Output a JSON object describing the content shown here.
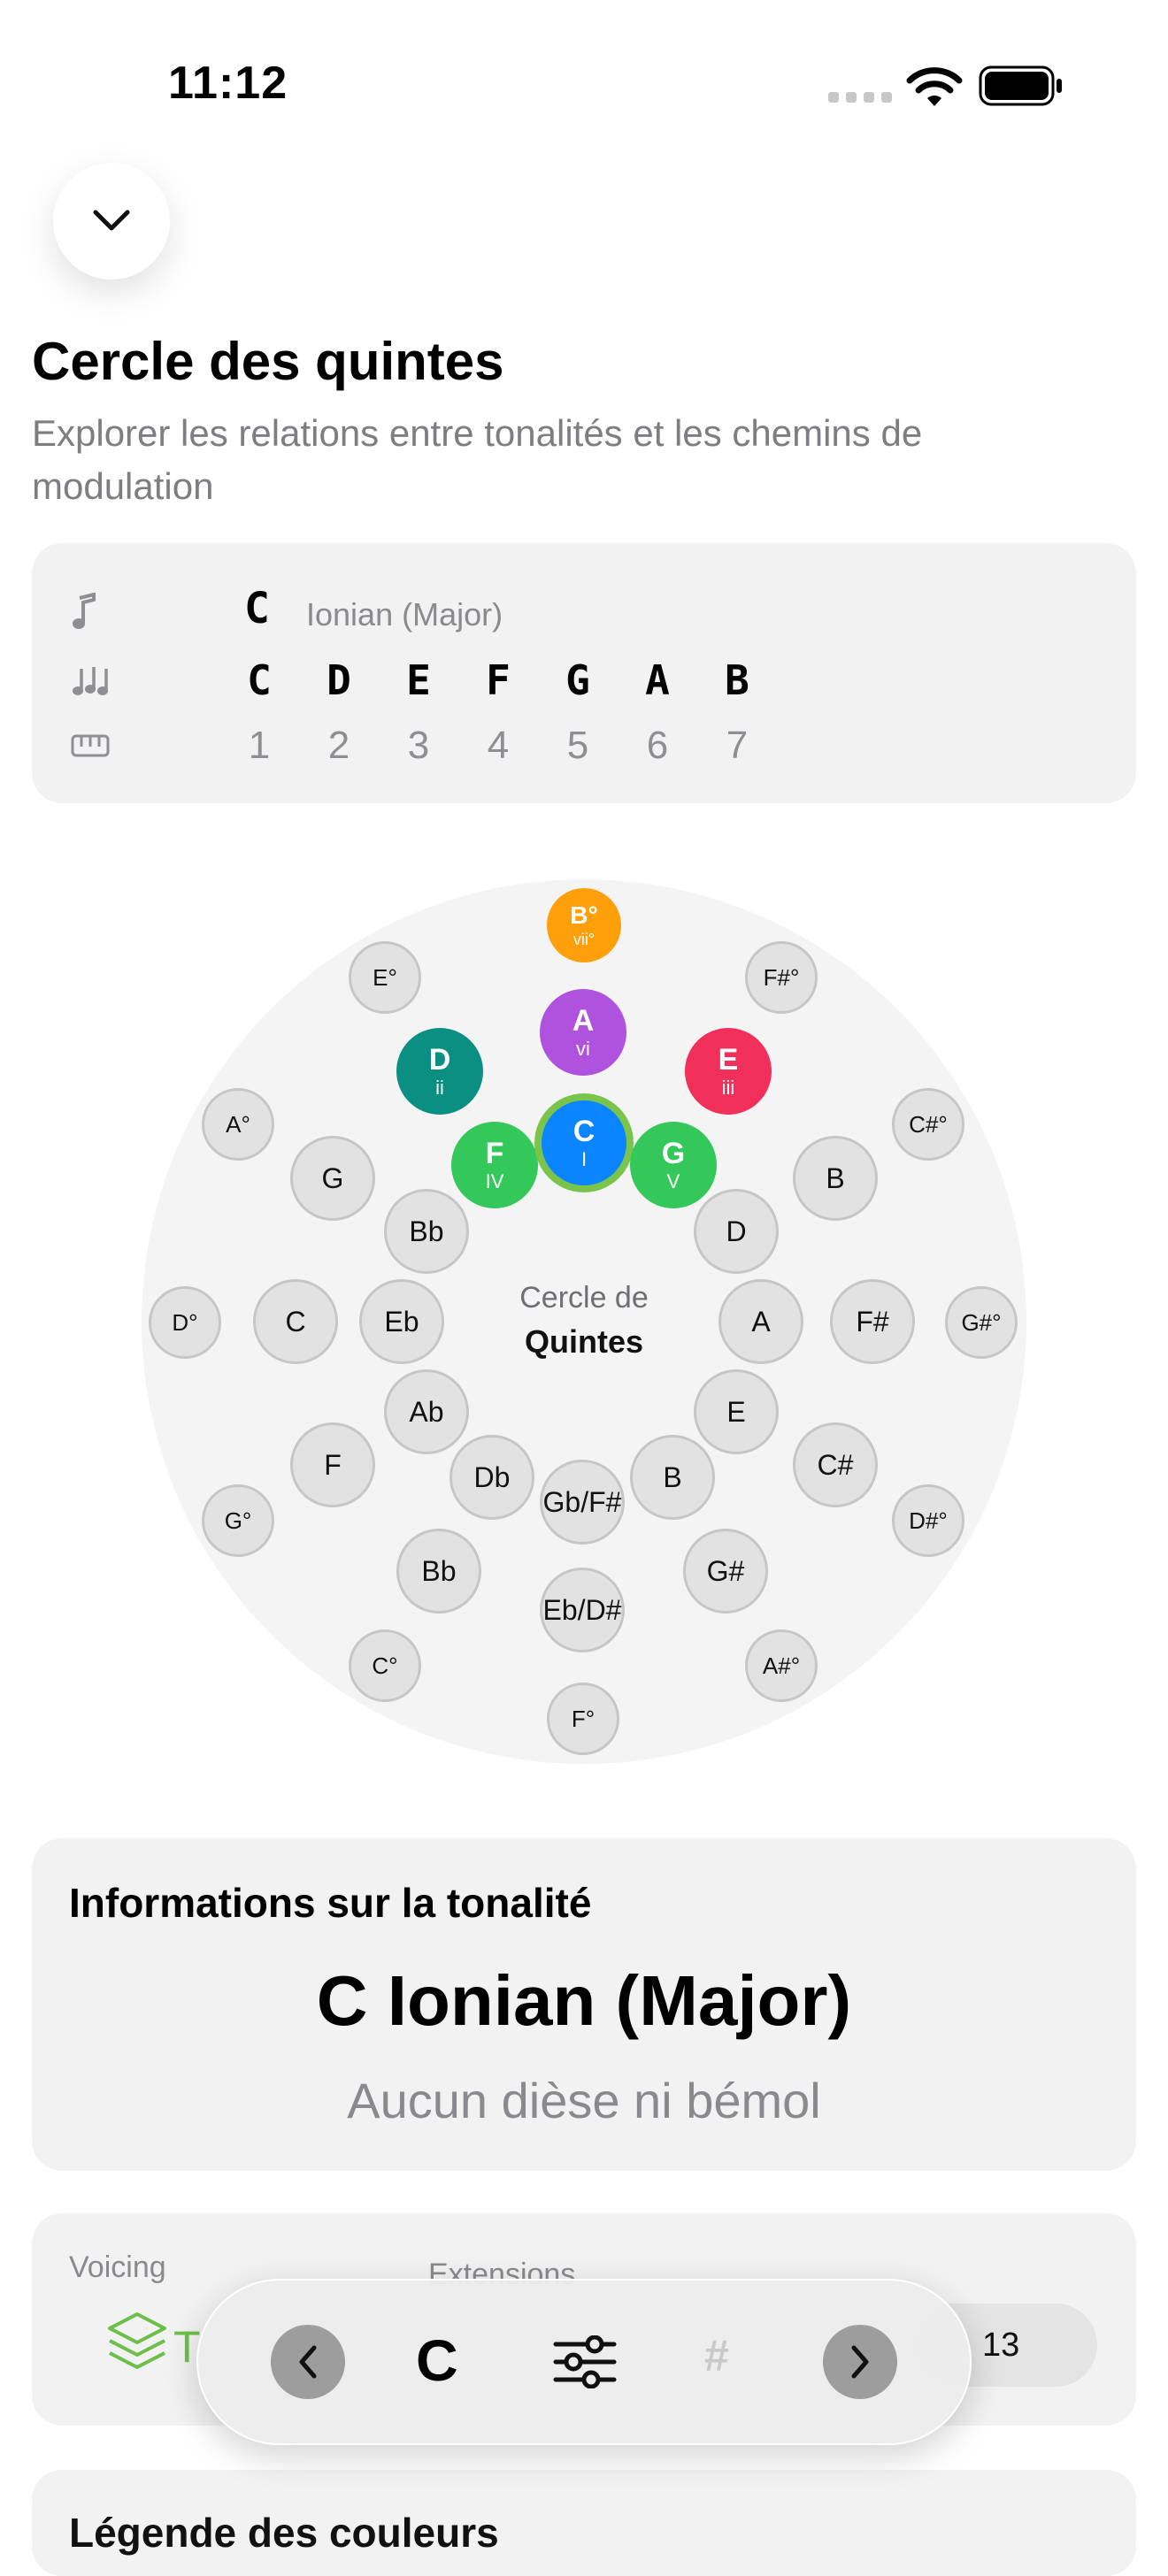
{
  "status_bar": {
    "time": "11:12"
  },
  "header": {
    "title": "Cercle des quintes",
    "subtitle": "Explorer les relations entre tonalités et les chemins de modulation"
  },
  "scale_card": {
    "root": "C",
    "mode": "Ionian (Major)",
    "notes": [
      "C",
      "D",
      "E",
      "F",
      "G",
      "A",
      "B"
    ],
    "degrees": [
      "1",
      "2",
      "3",
      "4",
      "5",
      "6",
      "7"
    ],
    "icons": [
      "music-note-icon",
      "music-notes-icon",
      "piano-keyboard-icon"
    ]
  },
  "circle": {
    "center_line1": "Cercle de",
    "center_line2": "Quintes",
    "selected_key": "C",
    "diatonic_colors": {
      "I": "#0a84ff",
      "ii": "#0a8f82",
      "iii": "#f0305a",
      "IV": "#34c759",
      "V": "#34c759",
      "vi": "#af52de",
      "vii": "#ff9f0a"
    },
    "diatonic": [
      {
        "note": "B°",
        "roman": "vii°"
      },
      {
        "note": "A",
        "roman": "vi"
      },
      {
        "note": "D",
        "roman": "ii"
      },
      {
        "note": "E",
        "roman": "iii"
      },
      {
        "note": "F",
        "roman": "IV"
      },
      {
        "note": "C",
        "roman": "I"
      },
      {
        "note": "G",
        "roman": "V"
      }
    ],
    "major_keys": [
      "G",
      "B",
      "D",
      "A",
      "E",
      "B",
      "Gb/F#",
      "Db",
      "Ab",
      "Eb",
      "Bb",
      "F",
      "C",
      "F#",
      "C#",
      "G#",
      "Eb/D#",
      "Bb",
      "C"
    ],
    "diminished_keys": [
      "E°",
      "F#°",
      "A°",
      "C#°",
      "D°",
      "G#°",
      "G°",
      "D#°",
      "C°",
      "A#°",
      "F°"
    ]
  },
  "info_card": {
    "title": "Informations sur la tonalité",
    "key_name": "C Ionian (Major)",
    "accidentals": "Aucun dièse ni bémol"
  },
  "voicing_card": {
    "voicing_label": "Voicing",
    "extensions_label": "Extensions",
    "voicing_value_visible": "T",
    "extension_value": "13"
  },
  "toolbar": {
    "key": "C",
    "sharp": "#"
  },
  "legend_card": {
    "title": "Légende des couleurs"
  }
}
